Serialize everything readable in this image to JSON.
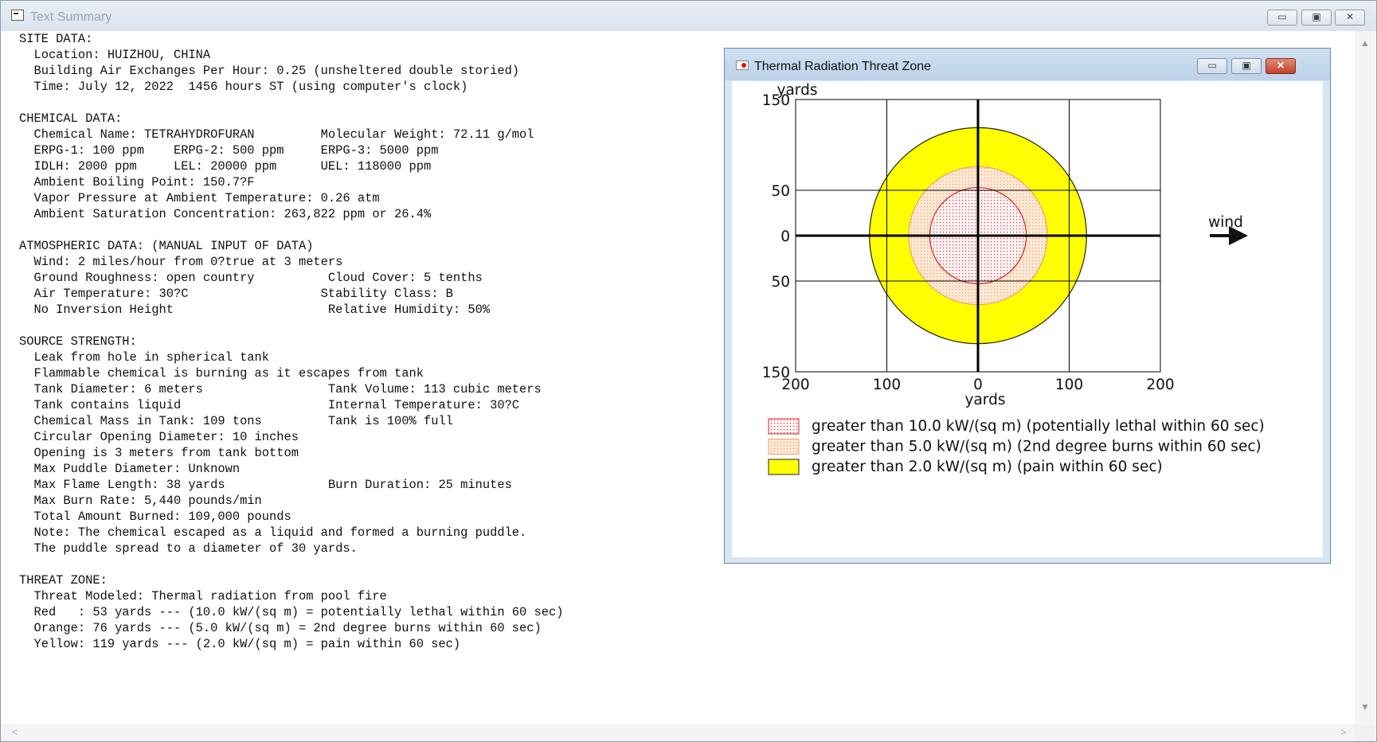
{
  "window": {
    "title": "Text Summary",
    "buttons": {
      "minimize": "▭",
      "restore": "▣",
      "close": "✕"
    }
  },
  "summary_text": "SITE DATA:\n  Location: HUIZHOU, CHINA\n  Building Air Exchanges Per Hour: 0.25 (unsheltered double storied)\n  Time: July 12, 2022  1456 hours ST (using computer's clock)\n\nCHEMICAL DATA:\n  Chemical Name: TETRAHYDROFURAN         Molecular Weight: 72.11 g/mol\n  ERPG-1: 100 ppm    ERPG-2: 500 ppm     ERPG-3: 5000 ppm\n  IDLH: 2000 ppm     LEL: 20000 ppm      UEL: 118000 ppm\n  Ambient Boiling Point: 150.7?F\n  Vapor Pressure at Ambient Temperature: 0.26 atm\n  Ambient Saturation Concentration: 263,822 ppm or 26.4%\n\nATMOSPHERIC DATA: (MANUAL INPUT OF DATA)\n  Wind: 2 miles/hour from 0?true at 3 meters\n  Ground Roughness: open country          Cloud Cover: 5 tenths\n  Air Temperature: 30?C                  Stability Class: B\n  No Inversion Height                     Relative Humidity: 50%\n\nSOURCE STRENGTH:\n  Leak from hole in spherical tank\n  Flammable chemical is burning as it escapes from tank\n  Tank Diameter: 6 meters                 Tank Volume: 113 cubic meters\n  Tank contains liquid                    Internal Temperature: 30?C\n  Chemical Mass in Tank: 109 tons         Tank is 100% full\n  Circular Opening Diameter: 10 inches\n  Opening is 3 meters from tank bottom\n  Max Puddle Diameter: Unknown\n  Max Flame Length: 38 yards              Burn Duration: 25 minutes\n  Max Burn Rate: 5,440 pounds/min\n  Total Amount Burned: 109,000 pounds\n  Note: The chemical escaped as a liquid and formed a burning puddle.\n  The puddle spread to a diameter of 30 yards.\n\nTHREAT ZONE:\n  Threat Modeled: Thermal radiation from pool fire\n  Red   : 53 yards --- (10.0 kW/(sq m) = potentially lethal within 60 sec)\n  Orange: 76 yards --- (5.0 kW/(sq m) = 2nd degree burns within 60 sec)\n  Yellow: 119 yards --- (2.0 kW/(sq m) = pain within 60 sec)",
  "threat_window": {
    "title": "Thermal Radiation Threat Zone",
    "buttons": {
      "minimize": "▭",
      "restore": "▣",
      "close": "✕"
    }
  },
  "chart_data": {
    "type": "threat-zone",
    "ylabel": "yards",
    "xlabel": "yards",
    "x_ticks": [
      -200,
      -100,
      0,
      100,
      200
    ],
    "x_tick_labels": [
      "200",
      "100",
      "0",
      "100",
      "200"
    ],
    "y_ticks": [
      150,
      50,
      0,
      -50,
      -150
    ],
    "y_tick_labels": [
      "150",
      "50",
      "0",
      "50",
      "150"
    ],
    "xlim": [
      -200,
      200
    ],
    "ylim": [
      -150,
      150
    ],
    "wind_label": "wind",
    "zones": [
      {
        "name": "Yellow",
        "radius": 119,
        "color": "#ffff00",
        "stroke": "#222222",
        "pattern": "solid",
        "legend": "greater than 2.0 kW/(sq m) (pain within 60 sec)"
      },
      {
        "name": "Orange",
        "radius": 76,
        "color": "#fde0c4",
        "stroke": "#f0a060",
        "pattern": "dots-orange",
        "legend": "greater than 5.0 kW/(sq m) (2nd degree burns within 60 sec)"
      },
      {
        "name": "Red",
        "radius": 53,
        "color": "#ffecec",
        "stroke": "#dd2222",
        "pattern": "dots-red",
        "legend": "greater than 10.0 kW/(sq m) (potentially lethal within 60 sec)"
      }
    ],
    "legend_order": [
      "Red",
      "Orange",
      "Yellow"
    ]
  }
}
